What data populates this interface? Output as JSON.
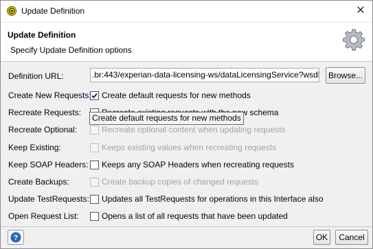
{
  "window": {
    "title": "Update Definition",
    "close_glyph": "✕"
  },
  "header": {
    "title": "Update Definition",
    "subtitle": "Specify Update Definition options"
  },
  "form": {
    "definition_url_label": "Definition URL:",
    "definition_url_value": ".br:443/experian-data-licensing-ws/dataLicensingService?wsdl",
    "browse_label": "Browse...",
    "rows": [
      {
        "label": "Create New Requests:",
        "text": "Create default requests for new methods",
        "checked": true,
        "enabled": true
      },
      {
        "label": "Recreate Requests:",
        "text": "Recreate existing requests with the new schema",
        "checked": false,
        "enabled": true
      },
      {
        "label": "Recreate Optional:",
        "text": "Recreate optional content when updating requests",
        "checked": false,
        "enabled": false
      },
      {
        "label": "Keep Existing:",
        "text": "Keeps existing values when recreating requests",
        "checked": false,
        "enabled": false
      },
      {
        "label": "Keep SOAP Headers:",
        "text": "Keeps any SOAP Headers when recreating requests",
        "checked": false,
        "enabled": true
      },
      {
        "label": "Create Backups:",
        "text": "Create backup copies of changed requests",
        "checked": false,
        "enabled": false
      },
      {
        "label": "Update TestRequests:",
        "text": "Updates all TestRequests for operations in this Interface also",
        "checked": false,
        "enabled": true
      },
      {
        "label": "Open Request List:",
        "text": "Opens a list of all requests that have been updated",
        "checked": false,
        "enabled": true
      }
    ]
  },
  "tooltip": {
    "text": "Create default requests for new methods"
  },
  "footer": {
    "ok_label": "OK",
    "cancel_label": "Cancel"
  },
  "icons": {
    "app": "soapui-logo-icon",
    "gear": "gear-icon",
    "help": "help-icon",
    "close": "close-icon"
  },
  "colors": {
    "accent": "#1f5fa8",
    "disabled_text": "#a3a3a3",
    "help_blue": "#2a62b8"
  }
}
